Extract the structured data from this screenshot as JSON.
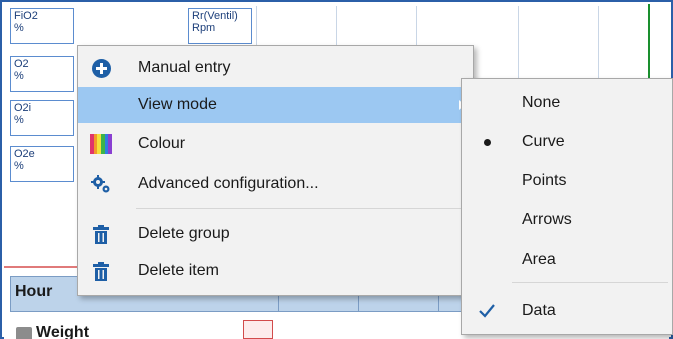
{
  "params": [
    {
      "name": "FiO2",
      "unit": "%"
    },
    {
      "name": "O2",
      "unit": "%"
    },
    {
      "name": "O2i",
      "unit": "%"
    },
    {
      "name": "O2e",
      "unit": "%"
    },
    {
      "name": "Rr(Ventil)",
      "unit": "Rpm"
    }
  ],
  "table": {
    "header": "Hour",
    "row_label": "Weight"
  },
  "context_menu": {
    "items": [
      {
        "label": "Manual entry",
        "icon": "plus-circle-icon"
      },
      {
        "label": "View mode",
        "icon": "",
        "highlighted": true,
        "has_submenu": true
      },
      {
        "label": "Colour",
        "icon": "colour-palette-icon"
      },
      {
        "label": "Advanced configuration...",
        "icon": "gears-icon"
      },
      {
        "label": "Delete group",
        "icon": "trash-icon"
      },
      {
        "label": "Delete item",
        "icon": "trash-icon"
      }
    ]
  },
  "view_mode_submenu": {
    "items": [
      {
        "label": "None",
        "selected": false
      },
      {
        "label": "Curve",
        "selected": true,
        "marker": "bullet"
      },
      {
        "label": "Points",
        "selected": false
      },
      {
        "label": "Arrows",
        "selected": false
      },
      {
        "label": "Area",
        "selected": false
      },
      {
        "label": "Data",
        "selected": true,
        "marker": "check"
      }
    ]
  },
  "colors": {
    "highlight": "#9cc8f2",
    "icon_blue": "#1e5fa6",
    "menu_bg": "#f2f2f2",
    "table_header": "#bdd3ea",
    "green_marker": "#1a8f2e"
  }
}
